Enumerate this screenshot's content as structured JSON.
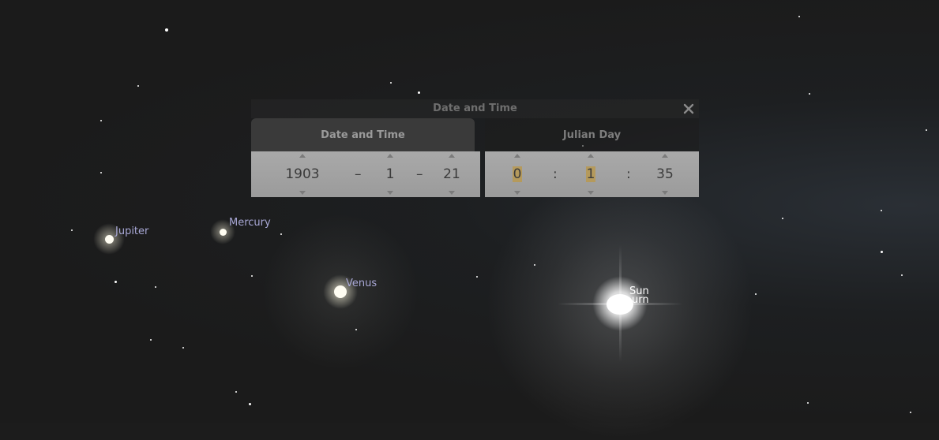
{
  "sky": {
    "labels": {
      "jupiter": "Jupiter",
      "mercury": "Mercury",
      "venus": "Venus",
      "sun": "Sun",
      "saturn_partial": "urn"
    }
  },
  "dialog": {
    "title": "Date and Time",
    "close_icon": "close-icon",
    "tabs": {
      "date_time": "Date and Time",
      "julian_day": "Julian Day"
    },
    "date": {
      "year": "1903",
      "month": "1",
      "day": "21",
      "separator": "–"
    },
    "time": {
      "hour": "0",
      "minute": "1",
      "second": "35",
      "separator": ":"
    }
  },
  "colors": {
    "sky": "#1c1c1c",
    "label": "#a9a8d6",
    "panel": "#a3a3a3",
    "highlight": "#b59a5c"
  }
}
